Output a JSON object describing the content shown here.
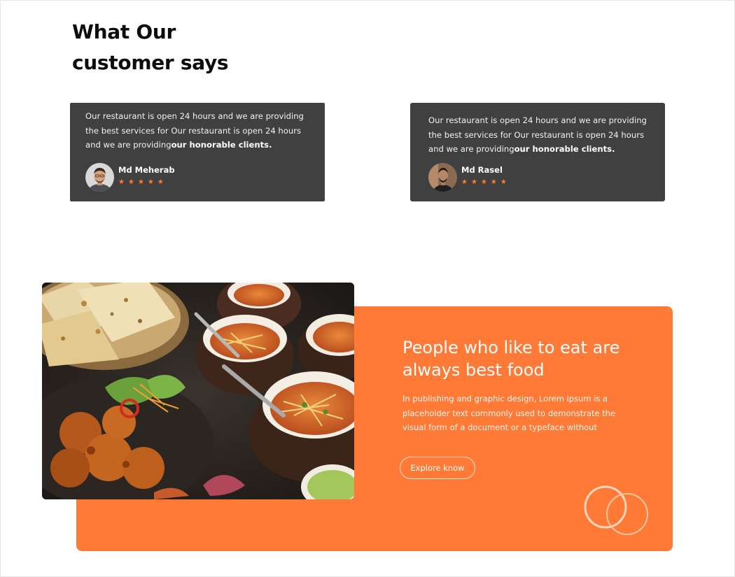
{
  "testimonials": {
    "heading_line1": "What Our",
    "heading_line2": "customer says",
    "cards": [
      {
        "text": "Our restaurant is open 24 hours and we are providing the best services for Our restaurant is open 24 hours and we are providing",
        "text_bold": "our honorable clients.",
        "name": "Md Meherab",
        "rating": 5
      },
      {
        "text": "Our restaurant is open 24 hours and we are providing the best services for Our restaurant is open 24 hours and we are providing",
        "text_bold": "our honorable clients.",
        "name": "Md Rasel",
        "rating": 5
      }
    ]
  },
  "promo": {
    "title": "People who like to eat are always best food",
    "description": "In publishing and graphic design, Lorem ipsum is a placeholder text commonly used to demonstrate the visual form of a document or a typeface without",
    "button_label": "Explore know"
  },
  "icons": {
    "star": "star-icon",
    "decor": "overlapping-rings-icon"
  },
  "colors": {
    "accent": "#ff7a37",
    "card_bg": "#404040",
    "star": "#ff7a2f"
  }
}
